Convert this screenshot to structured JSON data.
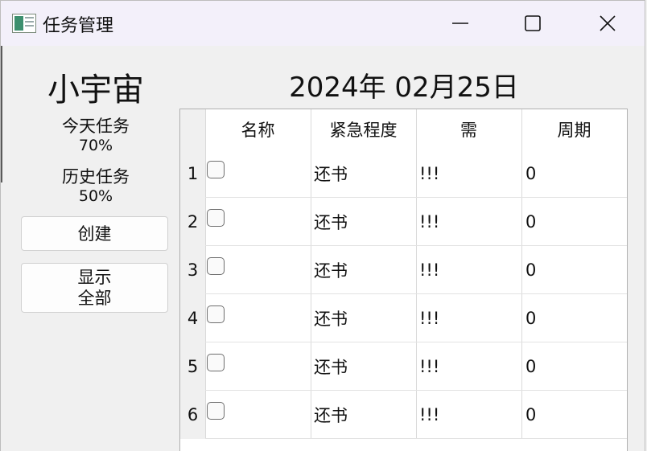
{
  "window": {
    "title": "任务管理",
    "icon": "app-window-icon",
    "controls": [
      "minimize-icon",
      "maximize-icon",
      "close-icon"
    ]
  },
  "sidebar": {
    "universe": "小宇宙",
    "today_label": "今天任务",
    "today_value": "70%",
    "history_label": "历史任务",
    "history_value": "50%",
    "create_label": "创建",
    "show_all_line1": "显示",
    "show_all_line2": "全部"
  },
  "date": "2024年 02月25日",
  "table": {
    "columns": [
      "名称",
      "紧急程度",
      "需",
      "周期"
    ],
    "rows": [
      {
        "index": "1",
        "name": "",
        "checked": false,
        "urgency": "还书",
        "need": "!!!",
        "cycle": "0"
      },
      {
        "index": "2",
        "name": "",
        "checked": false,
        "urgency": "还书",
        "need": "!!!",
        "cycle": "0"
      },
      {
        "index": "3",
        "name": "",
        "checked": false,
        "urgency": "还书",
        "need": "!!!",
        "cycle": "0"
      },
      {
        "index": "4",
        "name": "",
        "checked": false,
        "urgency": "还书",
        "need": "!!!",
        "cycle": "0"
      },
      {
        "index": "5",
        "name": "",
        "checked": false,
        "urgency": "还书",
        "need": "!!!",
        "cycle": "0"
      },
      {
        "index": "6",
        "name": "",
        "checked": false,
        "urgency": "还书",
        "need": "!!!",
        "cycle": "0"
      }
    ]
  }
}
